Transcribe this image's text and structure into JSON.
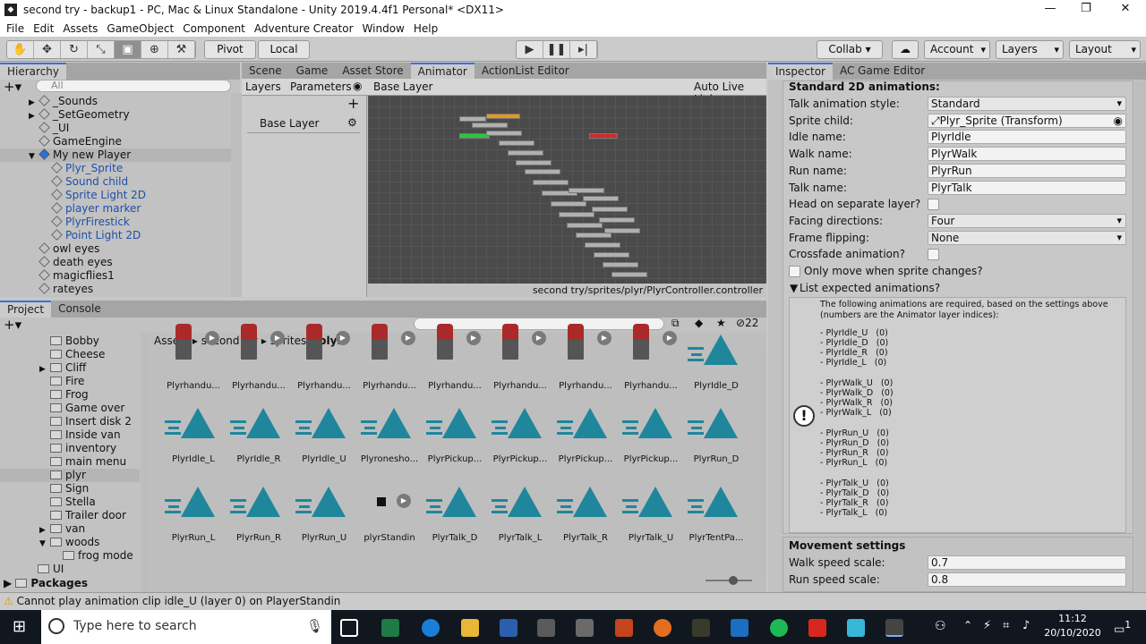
{
  "window": {
    "title": "second try - backup1 - PC, Mac & Linux Standalone - Unity 2019.4.4f1 Personal* <DX11>",
    "controls": [
      "—",
      "❐",
      "✕"
    ]
  },
  "menu": [
    "File",
    "Edit",
    "Assets",
    "GameObject",
    "Component",
    "Adventure Creator",
    "Window",
    "Help"
  ],
  "toolbar": {
    "pivot": "Pivot",
    "local": "Local",
    "collab": "Collab ▾",
    "account": "Account",
    "layers": "Layers",
    "layout": "Layout"
  },
  "hierarchy": {
    "tab": "Hierarchy",
    "search_placeholder": "All",
    "items": [
      {
        "label": "_Sounds",
        "indent": 1,
        "arrow": "▶"
      },
      {
        "label": "_SetGeometry",
        "indent": 1,
        "arrow": "▶"
      },
      {
        "label": "_UI",
        "indent": 1,
        "arrow": ""
      },
      {
        "label": "GameEngine",
        "indent": 1,
        "arrow": ""
      },
      {
        "label": "My new Player",
        "indent": 1,
        "arrow": "▼",
        "selected": true
      },
      {
        "label": "Plyr_Sprite",
        "indent": 2,
        "blue": true
      },
      {
        "label": "Sound child",
        "indent": 2,
        "blue": true
      },
      {
        "label": "Sprite Light 2D",
        "indent": 2,
        "blue": true
      },
      {
        "label": "player marker",
        "indent": 2,
        "blue": true
      },
      {
        "label": "PlyrFirestick",
        "indent": 2,
        "blue": true
      },
      {
        "label": "Point Light 2D",
        "indent": 2,
        "blue": true
      },
      {
        "label": "owl eyes",
        "indent": 1
      },
      {
        "label": "death eyes",
        "indent": 1
      },
      {
        "label": "magicflies1",
        "indent": 1
      },
      {
        "label": "rateyes",
        "indent": 1
      }
    ]
  },
  "center_tabs": [
    "Scene",
    "Game",
    "Asset Store",
    "Animator",
    "ActionList Editor"
  ],
  "animator": {
    "layers_tab": "Layers",
    "parameters_tab": "Parameters",
    "breadcrumb": "Base Layer",
    "auto_live": "Auto Live Link",
    "layer_name": "Base Layer",
    "path": "second try/sprites/plyr/PlyrController.controller"
  },
  "inspector": {
    "tabs": [
      "Inspector",
      "AC Game Editor"
    ],
    "section": "Standard 2D animations:",
    "fields": [
      {
        "label": "Talk animation style:",
        "value": "Standard",
        "type": "drop"
      },
      {
        "label": "Sprite child:",
        "value": "Plyr_Sprite (Transform)",
        "type": "obj"
      },
      {
        "label": "Idle name:",
        "value": "PlyrIdle",
        "type": "text"
      },
      {
        "label": "Walk name:",
        "value": "PlyrWalk",
        "type": "text"
      },
      {
        "label": "Run name:",
        "value": "PlyrRun",
        "type": "text"
      },
      {
        "label": "Talk name:",
        "value": "PlyrTalk",
        "type": "text"
      },
      {
        "label": "Head on separate layer?",
        "value": "",
        "type": "check"
      },
      {
        "label": "Facing directions:",
        "value": "Four",
        "type": "drop"
      },
      {
        "label": "Frame flipping:",
        "value": "None",
        "type": "drop"
      },
      {
        "label": "Crossfade animation?",
        "value": "",
        "type": "check"
      }
    ],
    "only_move": "Only move when sprite changes?",
    "list_expected": "List expected animations?",
    "help_intro": "The following animations are required, based on the settings above (numbers are the Animator layer indices):",
    "anims": [
      [
        "- PlyrIdle_U   (0)",
        "- PlyrIdle_D   (0)",
        "- PlyrIdle_R   (0)",
        "- PlyrIdle_L   (0)"
      ],
      [
        "- PlyrWalk_U   (0)",
        "- PlyrWalk_D   (0)",
        "- PlyrWalk_R   (0)",
        "- PlyrWalk_L   (0)"
      ],
      [
        "- PlyrRun_U   (0)",
        "- PlyrRun_D   (0)",
        "- PlyrRun_R   (0)",
        "- PlyrRun_L   (0)"
      ],
      [
        "- PlyrTalk_U   (0)",
        "- PlyrTalk_D   (0)",
        "- PlyrTalk_R   (0)",
        "- PlyrTalk_L   (0)"
      ]
    ],
    "movement": "Movement settings",
    "walk_speed_label": "Walk speed scale:",
    "walk_speed": "0.7",
    "run_speed_label": "Run speed scale:",
    "run_speed": "0.8"
  },
  "project": {
    "tabs": [
      "Project",
      "Console"
    ],
    "count": "22",
    "breadcrumb": [
      "Assets",
      "second try",
      "sprites",
      "plyr"
    ],
    "tree": [
      {
        "label": "Bobby",
        "indent": 3
      },
      {
        "label": "Cheese",
        "indent": 3
      },
      {
        "label": "Cliff",
        "indent": 3,
        "arrow": "▶"
      },
      {
        "label": "Fire",
        "indent": 3
      },
      {
        "label": "Frog",
        "indent": 3
      },
      {
        "label": "Game over",
        "indent": 3
      },
      {
        "label": "Insert disk 2",
        "indent": 3
      },
      {
        "label": "Inside van",
        "indent": 3
      },
      {
        "label": "inventory",
        "indent": 3
      },
      {
        "label": "main menu",
        "indent": 3
      },
      {
        "label": "plyr",
        "indent": 3,
        "selected": true
      },
      {
        "label": "Sign",
        "indent": 3
      },
      {
        "label": "Stella",
        "indent": 3
      },
      {
        "label": "Trailer door",
        "indent": 3
      },
      {
        "label": "van",
        "indent": 3,
        "arrow": "▶"
      },
      {
        "label": "woods",
        "indent": 3,
        "arrow": "▼"
      },
      {
        "label": "frog mode",
        "indent": 4
      },
      {
        "label": "UI",
        "indent": 2
      }
    ],
    "packages": "Packages",
    "assets": [
      [
        "Plyrhandu...",
        "Plyrhandu...",
        "Plyrhandu...",
        "Plyrhandu...",
        "Plyrhandu...",
        "Plyrhandu...",
        "Plyrhandu...",
        "Plyrhandu...",
        "PlyrIdle_D"
      ],
      [
        "PlyrIdle_L",
        "PlyrIdle_R",
        "PlyrIdle_U",
        "Plyronesho...",
        "PlyrPickup...",
        "PlyrPickup...",
        "PlyrPickup...",
        "PlyrPickup...",
        "PlyrRun_D"
      ],
      [
        "PlyrRun_L",
        "PlyrRun_R",
        "PlyrRun_U",
        "plyrStandin",
        "PlyrTalk_D",
        "PlyrTalk_L",
        "PlyrTalk_R",
        "PlyrTalk_U",
        "PlyrTentPa..."
      ]
    ]
  },
  "status": "Cannot play animation clip idle_U (layer 0) on PlayerStandin",
  "taskbar": {
    "search": "Type here to search",
    "time": "11:12",
    "date": "20/10/2020",
    "notif": "1"
  },
  "colors": {
    "accent": "#3a72d8",
    "asset": "#1f869c",
    "green": "#27c93a",
    "red": "#d42828",
    "orange": "#e49a1a"
  }
}
